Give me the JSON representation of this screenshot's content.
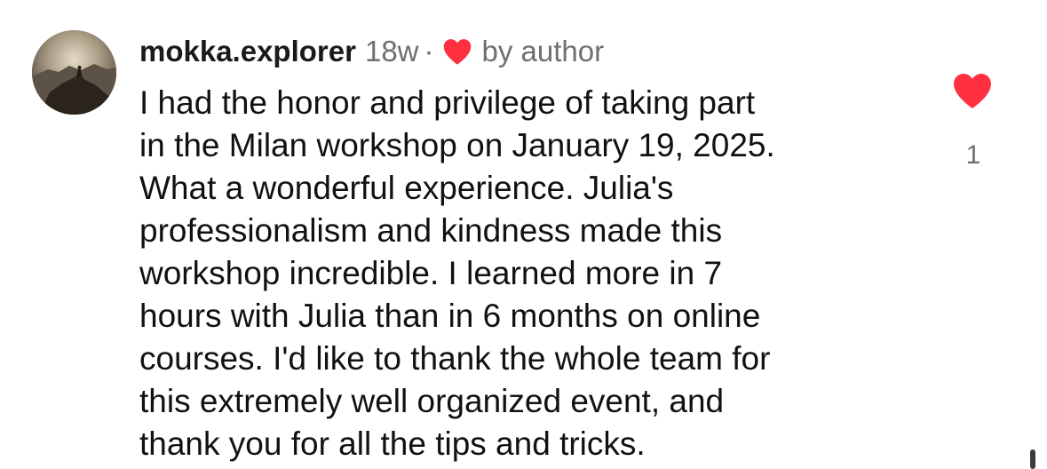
{
  "comment": {
    "username": "mokka.explorer",
    "timestamp": "18w",
    "separator": "·",
    "author_like_icon": "heart-icon",
    "author_like_label": "by author",
    "body_lines": [
      "I had the honor and privilege of taking part",
      "in the Milan workshop on January 19, 2025.",
      "What a wonderful experience. Julia's",
      "professionalism and kindness made this",
      "workshop incredible. I learned more in 7",
      "hours with Julia than in 6 months on online",
      "courses. I'd like to thank the whole team for",
      "this extremely well organized event, and",
      "thank you for all the tips and tricks."
    ],
    "like_count": "1",
    "like_icon": "heart-icon",
    "liked": true
  },
  "colors": {
    "heart": "#ff3040",
    "secondary_text": "#6e6e73",
    "primary_text": "#111111"
  }
}
